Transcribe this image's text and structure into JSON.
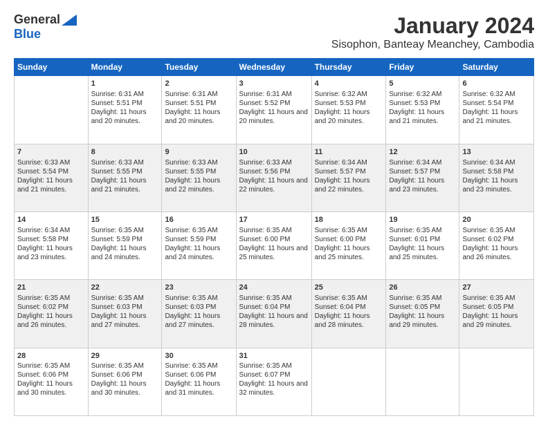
{
  "header": {
    "logo_general": "General",
    "logo_blue": "Blue",
    "month_title": "January 2024",
    "subtitle": "Sisophon, Banteay Meanchey, Cambodia"
  },
  "days_of_week": [
    "Sunday",
    "Monday",
    "Tuesday",
    "Wednesday",
    "Thursday",
    "Friday",
    "Saturday"
  ],
  "weeks": [
    [
      {
        "day": "",
        "info": ""
      },
      {
        "day": "1",
        "info": "Sunrise: 6:31 AM\nSunset: 5:51 PM\nDaylight: 11 hours and 20 minutes."
      },
      {
        "day": "2",
        "info": "Sunrise: 6:31 AM\nSunset: 5:51 PM\nDaylight: 11 hours and 20 minutes."
      },
      {
        "day": "3",
        "info": "Sunrise: 6:31 AM\nSunset: 5:52 PM\nDaylight: 11 hours and 20 minutes."
      },
      {
        "day": "4",
        "info": "Sunrise: 6:32 AM\nSunset: 5:53 PM\nDaylight: 11 hours and 20 minutes."
      },
      {
        "day": "5",
        "info": "Sunrise: 6:32 AM\nSunset: 5:53 PM\nDaylight: 11 hours and 21 minutes."
      },
      {
        "day": "6",
        "info": "Sunrise: 6:32 AM\nSunset: 5:54 PM\nDaylight: 11 hours and 21 minutes."
      }
    ],
    [
      {
        "day": "7",
        "info": "Sunrise: 6:33 AM\nSunset: 5:54 PM\nDaylight: 11 hours and 21 minutes."
      },
      {
        "day": "8",
        "info": "Sunrise: 6:33 AM\nSunset: 5:55 PM\nDaylight: 11 hours and 21 minutes."
      },
      {
        "day": "9",
        "info": "Sunrise: 6:33 AM\nSunset: 5:55 PM\nDaylight: 11 hours and 22 minutes."
      },
      {
        "day": "10",
        "info": "Sunrise: 6:33 AM\nSunset: 5:56 PM\nDaylight: 11 hours and 22 minutes."
      },
      {
        "day": "11",
        "info": "Sunrise: 6:34 AM\nSunset: 5:57 PM\nDaylight: 11 hours and 22 minutes."
      },
      {
        "day": "12",
        "info": "Sunrise: 6:34 AM\nSunset: 5:57 PM\nDaylight: 11 hours and 23 minutes."
      },
      {
        "day": "13",
        "info": "Sunrise: 6:34 AM\nSunset: 5:58 PM\nDaylight: 11 hours and 23 minutes."
      }
    ],
    [
      {
        "day": "14",
        "info": "Sunrise: 6:34 AM\nSunset: 5:58 PM\nDaylight: 11 hours and 23 minutes."
      },
      {
        "day": "15",
        "info": "Sunrise: 6:35 AM\nSunset: 5:59 PM\nDaylight: 11 hours and 24 minutes."
      },
      {
        "day": "16",
        "info": "Sunrise: 6:35 AM\nSunset: 5:59 PM\nDaylight: 11 hours and 24 minutes."
      },
      {
        "day": "17",
        "info": "Sunrise: 6:35 AM\nSunset: 6:00 PM\nDaylight: 11 hours and 25 minutes."
      },
      {
        "day": "18",
        "info": "Sunrise: 6:35 AM\nSunset: 6:00 PM\nDaylight: 11 hours and 25 minutes."
      },
      {
        "day": "19",
        "info": "Sunrise: 6:35 AM\nSunset: 6:01 PM\nDaylight: 11 hours and 25 minutes."
      },
      {
        "day": "20",
        "info": "Sunrise: 6:35 AM\nSunset: 6:02 PM\nDaylight: 11 hours and 26 minutes."
      }
    ],
    [
      {
        "day": "21",
        "info": "Sunrise: 6:35 AM\nSunset: 6:02 PM\nDaylight: 11 hours and 26 minutes."
      },
      {
        "day": "22",
        "info": "Sunrise: 6:35 AM\nSunset: 6:03 PM\nDaylight: 11 hours and 27 minutes."
      },
      {
        "day": "23",
        "info": "Sunrise: 6:35 AM\nSunset: 6:03 PM\nDaylight: 11 hours and 27 minutes."
      },
      {
        "day": "24",
        "info": "Sunrise: 6:35 AM\nSunset: 6:04 PM\nDaylight: 11 hours and 28 minutes."
      },
      {
        "day": "25",
        "info": "Sunrise: 6:35 AM\nSunset: 6:04 PM\nDaylight: 11 hours and 28 minutes."
      },
      {
        "day": "26",
        "info": "Sunrise: 6:35 AM\nSunset: 6:05 PM\nDaylight: 11 hours and 29 minutes."
      },
      {
        "day": "27",
        "info": "Sunrise: 6:35 AM\nSunset: 6:05 PM\nDaylight: 11 hours and 29 minutes."
      }
    ],
    [
      {
        "day": "28",
        "info": "Sunrise: 6:35 AM\nSunset: 6:06 PM\nDaylight: 11 hours and 30 minutes."
      },
      {
        "day": "29",
        "info": "Sunrise: 6:35 AM\nSunset: 6:06 PM\nDaylight: 11 hours and 30 minutes."
      },
      {
        "day": "30",
        "info": "Sunrise: 6:35 AM\nSunset: 6:06 PM\nDaylight: 11 hours and 31 minutes."
      },
      {
        "day": "31",
        "info": "Sunrise: 6:35 AM\nSunset: 6:07 PM\nDaylight: 11 hours and 32 minutes."
      },
      {
        "day": "",
        "info": ""
      },
      {
        "day": "",
        "info": ""
      },
      {
        "day": "",
        "info": ""
      }
    ]
  ]
}
